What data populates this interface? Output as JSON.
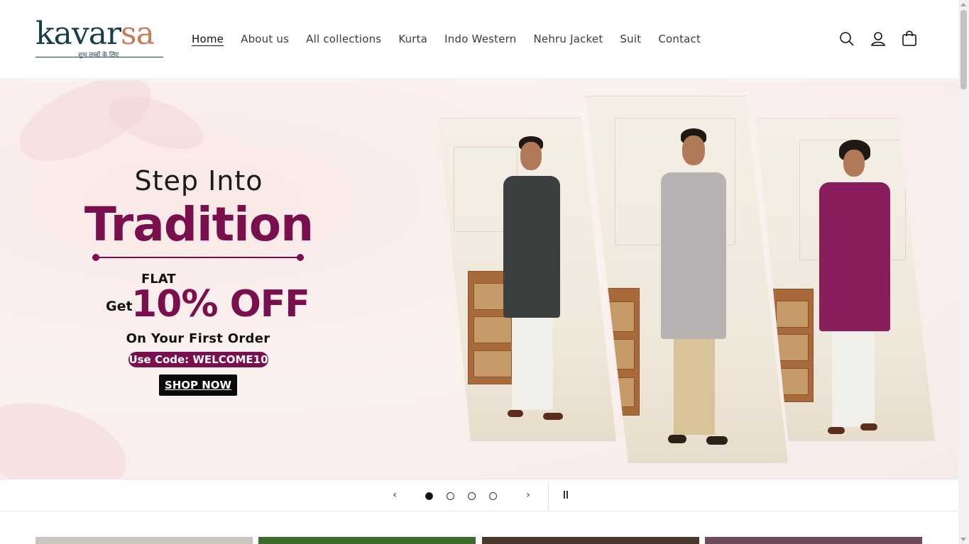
{
  "brand": {
    "name_part1": "kavar",
    "name_part2": "sa",
    "tagline": "शुभ लम्हों के लिए",
    "colors": {
      "primary": "#163e4a",
      "accent": "#c97a5a"
    }
  },
  "nav": {
    "items": [
      {
        "label": "Home",
        "active": true
      },
      {
        "label": "About us",
        "active": false
      },
      {
        "label": "All collections",
        "active": false
      },
      {
        "label": "Kurta",
        "active": false
      },
      {
        "label": "Indo Western",
        "active": false
      },
      {
        "label": "Nehru Jacket",
        "active": false
      },
      {
        "label": "Suit",
        "active": false
      },
      {
        "label": "Contact",
        "active": false
      }
    ]
  },
  "header_icons": [
    "search-icon",
    "account-icon",
    "cart-icon"
  ],
  "hero": {
    "line1": "Step Into",
    "line2": "Tradition",
    "flat": "FLAT",
    "get": "Get",
    "discount": "10% OFF",
    "subtitle": "On Your First Order",
    "code_label": "Use Code: WELCOME10",
    "cta": "SHOP NOW",
    "colors": {
      "accent": "#7a0f4d",
      "kurta_left": "#3b3f40",
      "kurta_center": "#b7b3b3",
      "kurta_right": "#8a1e5c"
    }
  },
  "slider": {
    "slide_count": 4,
    "active_slide": 1,
    "prev_icon": "chevron-left-icon",
    "next_icon": "chevron-right-icon",
    "pause_icon": "pause-icon"
  },
  "collections_preview": {
    "thumb_colors": [
      "#c9c6bf",
      "#3e6a2c",
      "#4a3a2e",
      "#6b4a5a"
    ]
  }
}
